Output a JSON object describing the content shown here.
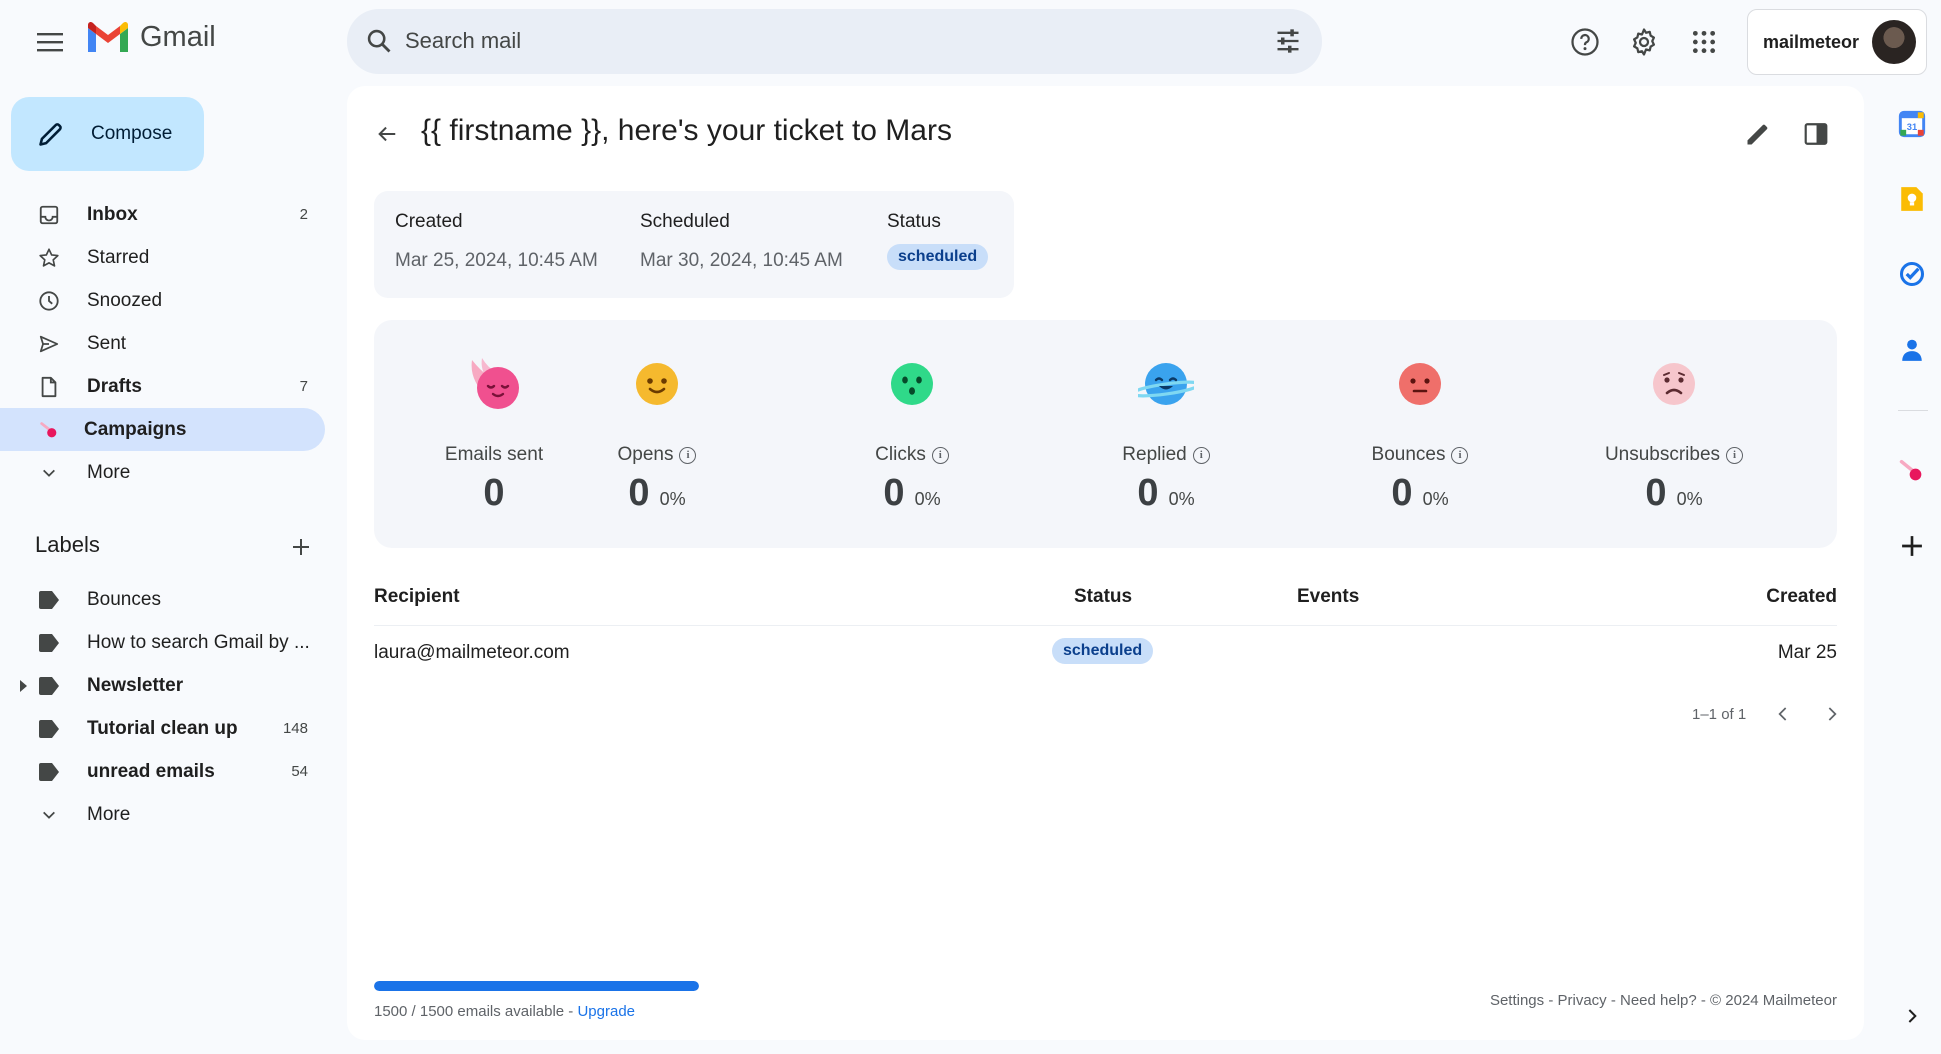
{
  "app": {
    "name": "Gmail"
  },
  "search": {
    "placeholder": "Search mail"
  },
  "account": {
    "name": "mailmeteor"
  },
  "compose": {
    "label": "Compose"
  },
  "nav": [
    {
      "label": "Inbox",
      "count": "2",
      "icon": "inbox-icon",
      "bold": true
    },
    {
      "label": "Starred",
      "count": "",
      "icon": "star-icon",
      "bold": false
    },
    {
      "label": "Snoozed",
      "count": "",
      "icon": "clock-icon",
      "bold": false
    },
    {
      "label": "Sent",
      "count": "",
      "icon": "send-icon",
      "bold": false
    },
    {
      "label": "Drafts",
      "count": "7",
      "icon": "draft-icon",
      "bold": true
    },
    {
      "label": "Campaigns",
      "count": "",
      "icon": "meteor-icon",
      "bold": true,
      "active": true
    },
    {
      "label": "More",
      "count": "",
      "icon": "chevron-down-icon",
      "bold": false
    }
  ],
  "labels": {
    "heading": "Labels",
    "items": [
      {
        "label": "Bounces",
        "count": "",
        "bold": false
      },
      {
        "label": "How to search Gmail by ...",
        "count": "",
        "bold": false
      },
      {
        "label": "Newsletter",
        "count": "",
        "bold": true,
        "expandable": true
      },
      {
        "label": "Tutorial clean up",
        "count": "148",
        "bold": true
      },
      {
        "label": "unread emails",
        "count": "54",
        "bold": true
      },
      {
        "label": "More",
        "count": "",
        "bold": false,
        "more": true
      }
    ]
  },
  "campaign": {
    "title": "{{ firstname }}, here's your ticket to Mars",
    "meta": {
      "created_label": "Created",
      "created_value": "Mar 25, 2024, 10:45 AM",
      "scheduled_label": "Scheduled",
      "scheduled_value": "Mar 30, 2024, 10:45 AM",
      "status_label": "Status",
      "status_value": "scheduled"
    },
    "stats": [
      {
        "label": "Emails sent",
        "value": "0",
        "pct": "",
        "info": false,
        "color": "#f0508f"
      },
      {
        "label": "Opens",
        "value": "0",
        "pct": "0%",
        "info": true,
        "color": "#f5b92e"
      },
      {
        "label": "Clicks",
        "value": "0",
        "pct": "0%",
        "info": true,
        "color": "#2fd989"
      },
      {
        "label": "Replied",
        "value": "0",
        "pct": "0%",
        "info": true,
        "color": "#3aa3ee"
      },
      {
        "label": "Bounces",
        "value": "0",
        "pct": "0%",
        "info": true,
        "color": "#ef6f6a"
      },
      {
        "label": "Unsubscribes",
        "value": "0",
        "pct": "0%",
        "info": true,
        "color": "#f6c6cc"
      }
    ]
  },
  "table": {
    "headers": {
      "recipient": "Recipient",
      "status": "Status",
      "events": "Events",
      "created": "Created"
    },
    "rows": [
      {
        "recipient": "laura@mailmeteor.com",
        "status": "scheduled",
        "events": "",
        "created": "Mar 25"
      }
    ],
    "pager": "1–1 of 1"
  },
  "quota": {
    "text": "1500 / 1500 emails available - ",
    "link": "Upgrade",
    "fraction": 1.0
  },
  "footer": {
    "text": "Settings - Privacy - Need help? - © 2024 Mailmeteor"
  },
  "colors": {
    "accent": "#1a73e8",
    "active_nav": "#d3e3fd",
    "compose": "#c2e7ff",
    "badge_bg": "#c8def9"
  }
}
